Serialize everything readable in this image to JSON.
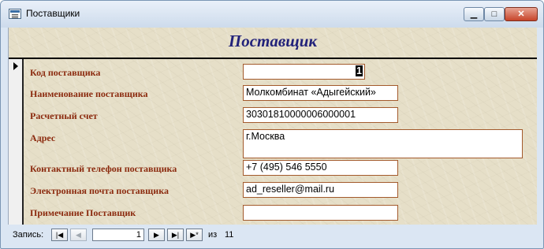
{
  "window": {
    "title": "Поставщики",
    "minimize": "▁",
    "maximize": "□",
    "close": "✕"
  },
  "form": {
    "title": "Поставщик",
    "fields": [
      {
        "label": "Код поставщика",
        "value": "1"
      },
      {
        "label": "Наименование поставщика",
        "value": "Молкомбинат «Адыгейский»"
      },
      {
        "label": "Расчетный счет",
        "value": "30301810000006000001"
      },
      {
        "label": "Адрес",
        "value": "г.Москва"
      },
      {
        "label": "Контактный телефон поставщика",
        "value": "+7 (495) 546 5550"
      },
      {
        "label": "Электронная почта поставщика",
        "value": "ad_reseller@mail.ru"
      },
      {
        "label": "Примечание Поставщик",
        "value": ""
      }
    ]
  },
  "navigation": {
    "label": "Запись:",
    "first": "|◀",
    "prev": "◀",
    "current": "1",
    "next": "▶",
    "last": "▶|",
    "new": "▶*",
    "of": "из",
    "total": "11"
  }
}
